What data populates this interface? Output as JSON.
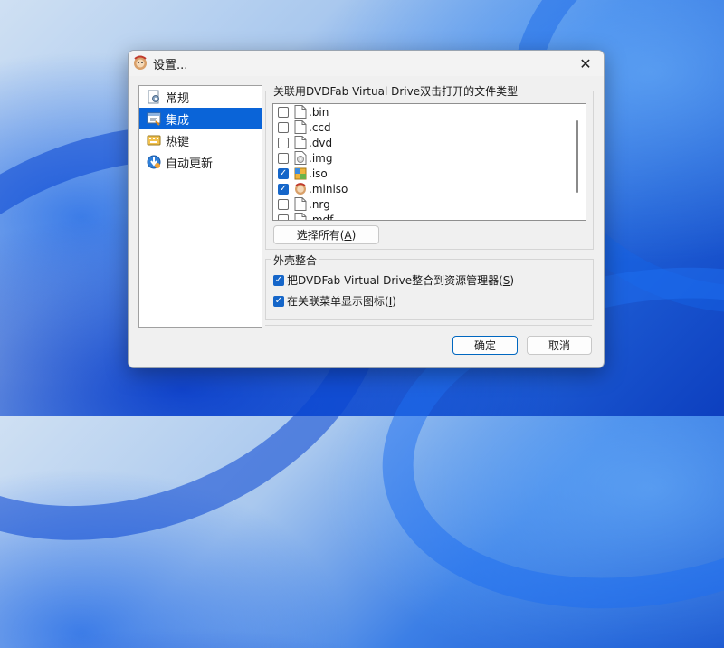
{
  "window": {
    "title": "设置..."
  },
  "nav": {
    "items": [
      {
        "label": "常规",
        "icon": "general-settings-icon",
        "selected": false
      },
      {
        "label": "集成",
        "icon": "integration-icon",
        "selected": true
      },
      {
        "label": "热键",
        "icon": "hotkey-keyboard-icon",
        "selected": false
      },
      {
        "label": "自动更新",
        "icon": "auto-update-icon",
        "selected": false
      }
    ]
  },
  "file_assoc": {
    "group_label": "关联用DVDFab Virtual Drive双击打开的文件类型",
    "files": [
      {
        "ext": ".bin",
        "checked": false,
        "icon": "blank-file-icon"
      },
      {
        "ext": ".ccd",
        "checked": false,
        "icon": "blank-file-icon"
      },
      {
        "ext": ".dvd",
        "checked": false,
        "icon": "blank-file-icon"
      },
      {
        "ext": ".img",
        "checked": false,
        "icon": "disc-image-file-icon"
      },
      {
        "ext": ".iso",
        "checked": true,
        "icon": "iso-archive-icon"
      },
      {
        "ext": ".miniso",
        "checked": true,
        "icon": "miniso-app-icon"
      },
      {
        "ext": ".nrg",
        "checked": false,
        "icon": "blank-file-icon"
      },
      {
        "ext": ".mdf",
        "checked": false,
        "icon": "blank-file-icon"
      }
    ],
    "select_all_label": "选择所有",
    "select_all_key": "A"
  },
  "shell": {
    "group_label": "外壳整合",
    "options": [
      {
        "label": "把DVDFab Virtual Drive整合到资源管理器",
        "key": "S",
        "checked": true
      },
      {
        "label": "在关联菜单显示图标",
        "key": "I",
        "checked": true
      }
    ]
  },
  "buttons": {
    "ok": "确定",
    "cancel": "取消"
  },
  "colors": {
    "selection": "#0a64d8",
    "checkbox": "#1566c9"
  }
}
